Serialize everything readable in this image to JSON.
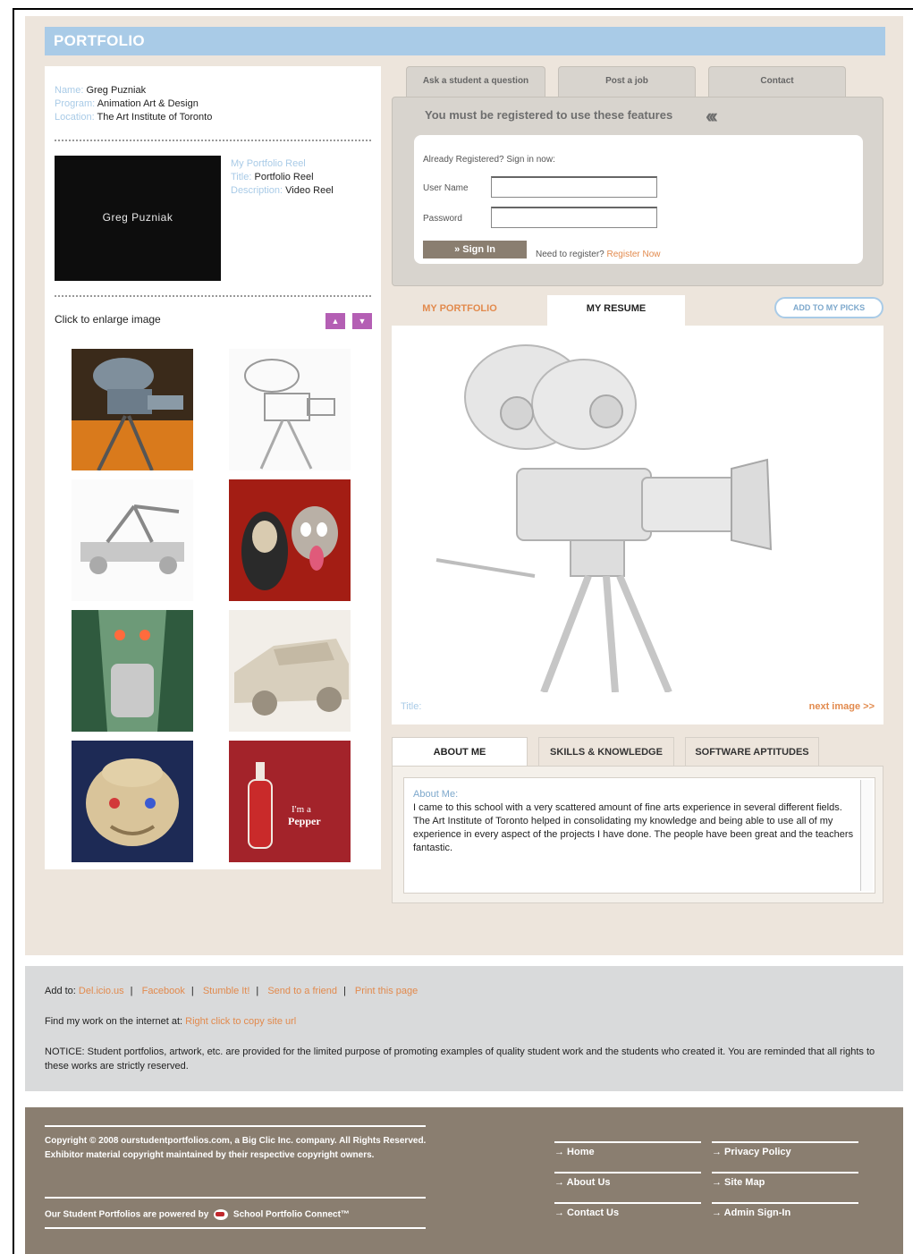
{
  "header": {
    "title": "PORTFOLIO"
  },
  "student": {
    "name_label": "Name:",
    "name": "Greg Puzniak",
    "program_label": "Program:",
    "program": "Animation Art & Design",
    "location_label": "Location:",
    "location": "The Art Institute of Toronto"
  },
  "reel": {
    "thumb_text": "Greg Puzniak",
    "link": "My Portfolio Reel",
    "title_label": "Title:",
    "title": "Portfolio Reel",
    "description_label": "Description:",
    "description": "Video Reel"
  },
  "gallery": {
    "enlarge_text": "Click to enlarge image",
    "up_icon": "▲",
    "down_icon": "▼",
    "thumbnails": [
      {
        "icon": "camera-thumb",
        "bg": "#c7731f"
      },
      {
        "icon": "camera-sketch-thumb",
        "bg": "#f2f2f2"
      },
      {
        "icon": "catapult-thumb",
        "bg": "#f4f4f4"
      },
      {
        "icon": "characters-thumb",
        "bg": "#9a1a12"
      },
      {
        "icon": "car-tunnel-thumb",
        "bg": "#3e6b4e"
      },
      {
        "icon": "car-clay-thumb",
        "bg": "#e8e2d8"
      },
      {
        "icon": "face-sculpt-thumb",
        "bg": "#1f2e5e"
      },
      {
        "icon": "pepper-bottle-thumb",
        "bg": "#9c1f24"
      }
    ]
  },
  "top_tabs": [
    "Ask a student a question",
    "Post a job",
    "Contact"
  ],
  "registration": {
    "message": "You must be registered to use these features",
    "chevrons": "‹‹‹",
    "already": "Already Registered? Sign in now:",
    "username_label": "User Name",
    "password_label": "Password",
    "username_value": "",
    "password_value": "",
    "signin_label": "» Sign In",
    "need_register": "Need to register?",
    "register_link": "Register Now"
  },
  "view_tabs": {
    "portfolio": "MY PORTFOLIO",
    "resume": "MY RESUME",
    "picks": "ADD TO MY PICKS"
  },
  "viewer": {
    "title_label": "Title:",
    "next": "next image >>"
  },
  "about_tabs": [
    "ABOUT ME",
    "SKILLS & KNOWLEDGE",
    "SOFTWARE APTITUDES"
  ],
  "about": {
    "heading": "About Me:",
    "text": "I came to this school with a very scattered amount of fine arts experience in several different fields. The Art Institute of Toronto helped in consolidating my knowledge and being able to use all of my experience in every aspect of the projects I have done. The people have been great and the teachers fantastic."
  },
  "share": {
    "add_to_label": "Add to:",
    "links": [
      "Del.icio.us",
      "Facebook",
      "Stumble It!",
      "Send to a friend",
      "Print this page"
    ],
    "find_label": "Find my work on the internet at:",
    "find_link": "Right click to copy site url",
    "notice": "NOTICE: Student portfolios, artwork, etc. are provided for the limited purpose of promoting examples of quality student work and the students who created it. You are reminded that all rights to these works are strictly reserved."
  },
  "footer": {
    "copyright": "Copyright © 2008 ourstudentportfolios.com, a Big Clic Inc. company. All Rights Reserved. Exhibitor material copyright maintained by their respective copyright owners.",
    "powered_pre": "Our Student Portfolios are powered by",
    "powered_brand": "School Portfolio Connect™",
    "links_left": [
      "→ Home",
      "→ About Us",
      "→ Contact Us"
    ],
    "links_right": [
      "→ Privacy Policy",
      "→ Site Map",
      "→ Admin Sign-In"
    ]
  },
  "colors": {
    "accent_blue": "#a9cbe7",
    "link_orange": "#e28a4d",
    "footer_brown": "#8a7e70",
    "beige": "#ede5dc"
  }
}
